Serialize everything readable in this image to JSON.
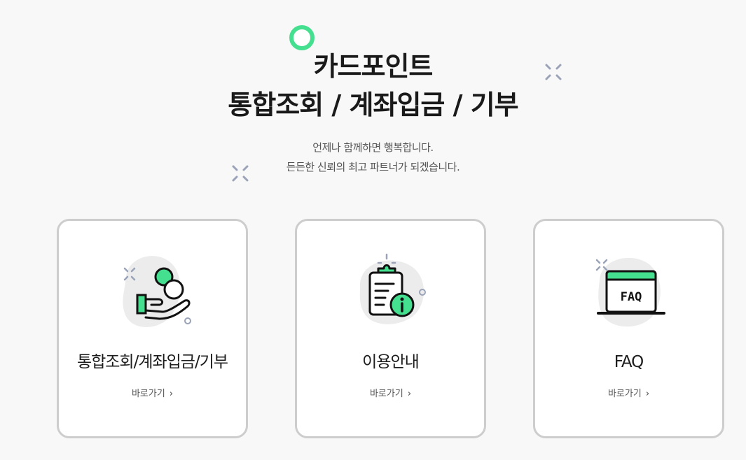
{
  "hero": {
    "title_line1": "카드포인트",
    "title_line2": "통합조회 / 계좌입금 / 기부",
    "subtitle_line1": "언제나 함께하면 행복합니다.",
    "subtitle_line2": "든든한 신뢰의 최고 파트너가 되겠습니다."
  },
  "cards": [
    {
      "title": "통합조회/계좌입금/기부",
      "link": "바로가기",
      "icon": "hand-coin-icon"
    },
    {
      "title": "이용안내",
      "link": "바로가기",
      "icon": "clipboard-info-icon"
    },
    {
      "title": "FAQ",
      "link": "바로가기",
      "icon": "faq-window-icon",
      "icon_text": "FAQ"
    }
  ],
  "colors": {
    "accent": "#45e08f",
    "border": "#cdcdcd",
    "blob": "#ececec",
    "sparkle": "#9aa3b8"
  }
}
